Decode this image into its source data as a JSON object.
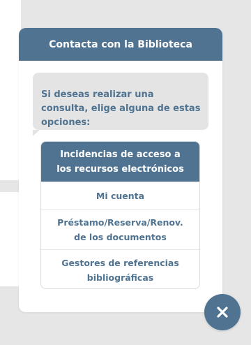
{
  "widget": {
    "title": "Contacta con la Biblioteca",
    "message": "Si deseas realizar una consulta, elige alguna de estas opciones:",
    "options": [
      {
        "line1": "Incidencias de acceso a",
        "line2": "los recursos electrónicos"
      },
      {
        "line1": "Mi cuenta",
        "line2": ""
      },
      {
        "line1": "Préstamo/Reserva/Renov.",
        "line2": "de los documentos"
      },
      {
        "line1": "Gestores de referencias",
        "line2": "bibliográficas"
      }
    ]
  },
  "colors": {
    "accent": "#4f7391",
    "bubble": "#e4e4e4",
    "background": "#e6e6e6"
  },
  "icons": {
    "close": "close-icon"
  }
}
